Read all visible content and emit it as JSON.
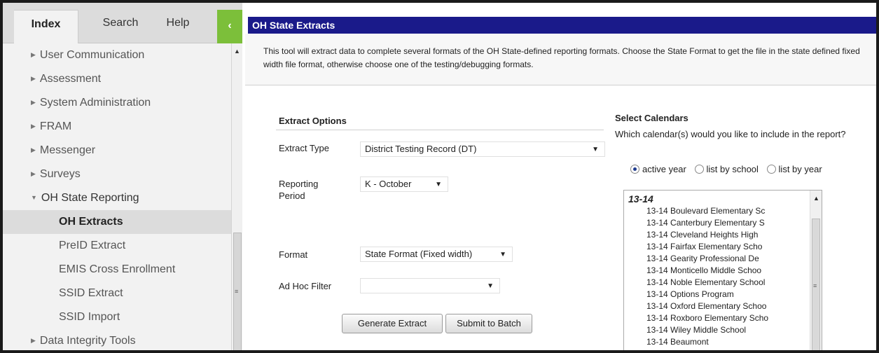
{
  "tabs": {
    "index": "Index",
    "search": "Search",
    "help": "Help",
    "collapse": "‹"
  },
  "nav": {
    "items": [
      {
        "label": "User Communication"
      },
      {
        "label": "Assessment"
      },
      {
        "label": "System Administration"
      },
      {
        "label": "FRAM"
      },
      {
        "label": "Messenger"
      },
      {
        "label": "Surveys"
      },
      {
        "label": "OH State Reporting"
      },
      {
        "label": "OH Extracts"
      },
      {
        "label": "PreID Extract"
      },
      {
        "label": "EMIS Cross Enrollment"
      },
      {
        "label": "SSID Extract"
      },
      {
        "label": "SSID Import"
      },
      {
        "label": "Data Integrity Tools"
      }
    ]
  },
  "main": {
    "title": "OH State Extracts",
    "description": "This tool will extract data to complete several formats of the OH State-defined reporting formats. Choose the State Format to get the file in the state defined fixed width file format, otherwise choose one of the testing/debugging formats.",
    "extract_options": {
      "heading": "Extract Options",
      "extract_type_label": "Extract Type",
      "extract_type_value": "District Testing Record (DT)",
      "reporting_period_label": "Reporting Period",
      "reporting_period_value": "K - October",
      "format_label": "Format",
      "format_value": "State Format (Fixed width)",
      "ad_hoc_label": "Ad Hoc Filter",
      "ad_hoc_value": ""
    },
    "buttons": {
      "generate": "Generate Extract",
      "batch": "Submit to Batch"
    },
    "calendars": {
      "heading": "Select Calendars",
      "question": "Which calendar(s) would you like to include in the report?",
      "radio_active": "active year",
      "radio_school": "list by school",
      "radio_year": "list by year",
      "year_group": "13-14",
      "items": [
        "13-14 Boulevard Elementary Sc",
        "13-14 Canterbury Elementary S",
        "13-14 Cleveland Heights High",
        "13-14 Fairfax Elementary Scho",
        "13-14 Gearity Professional De",
        "13-14 Monticello Middle Schoo",
        "13-14 Noble Elementary School",
        "13-14 Options Program",
        "13-14 Oxford Elementary Schoo",
        "13-14 Roxboro Elementary Scho",
        "13-14 Wiley Middle School",
        "13-14 Beaumont"
      ]
    }
  },
  "colors": {
    "title_bar": "#1a1a8a",
    "collapse_button": "#7cbf3a"
  }
}
